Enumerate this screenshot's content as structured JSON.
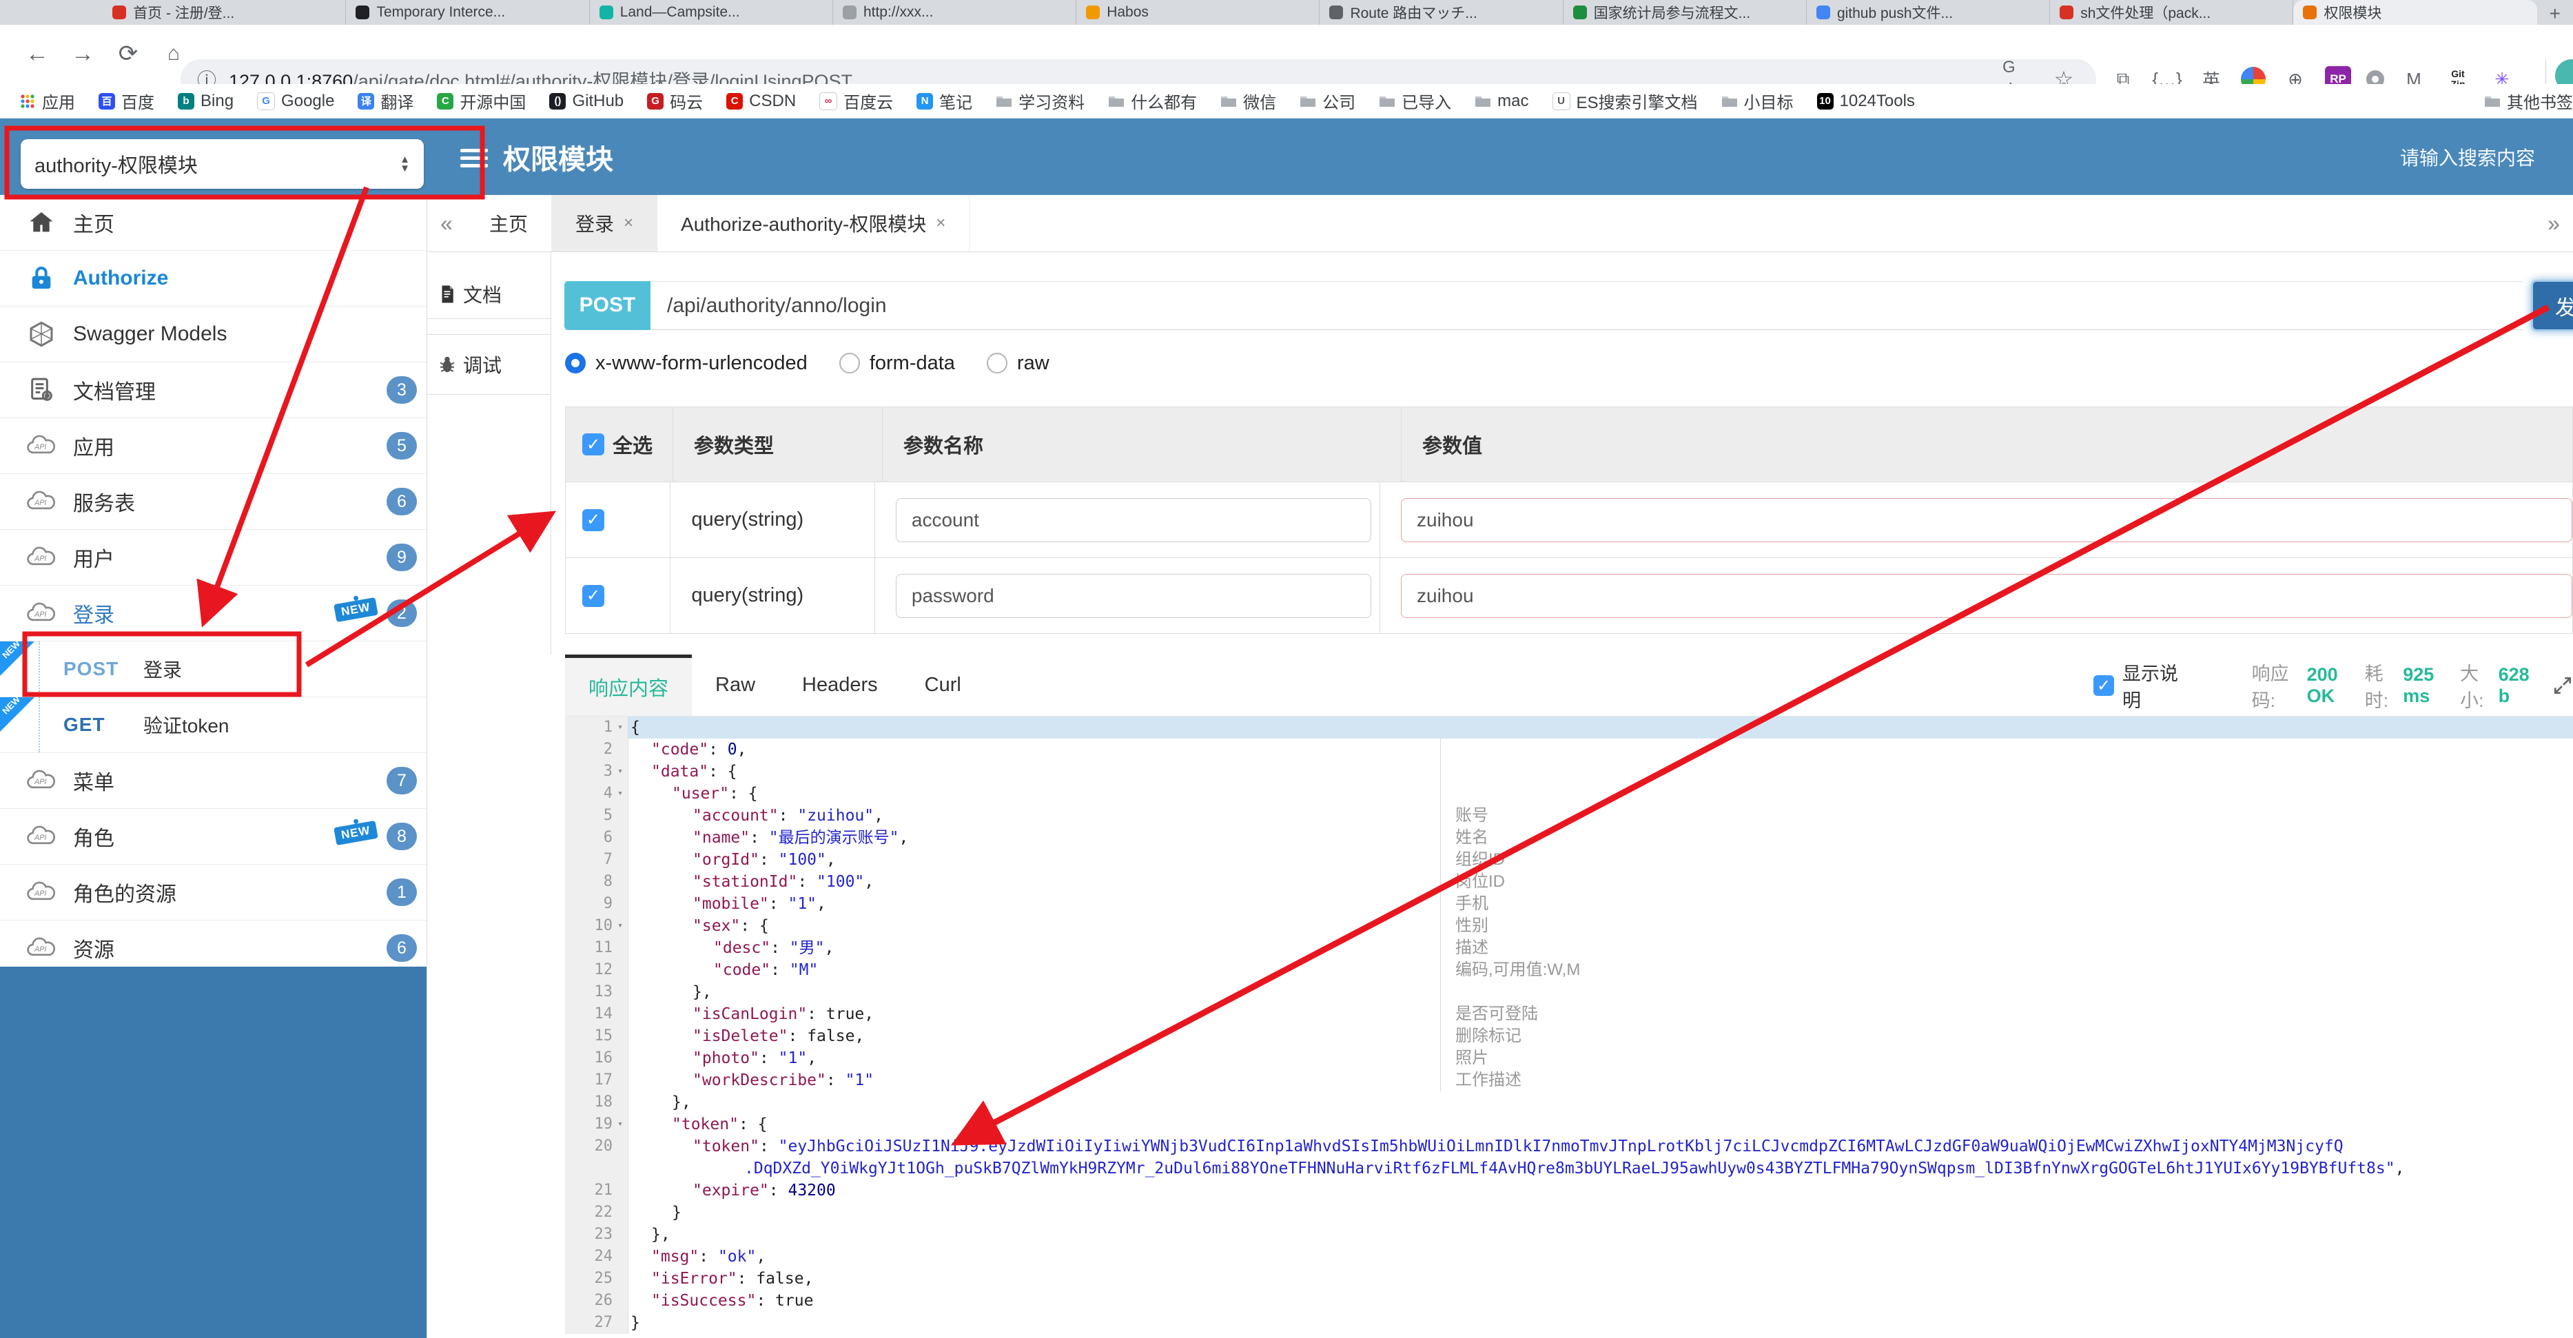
{
  "browser": {
    "tabs": [
      {
        "title": "首页 - 注册/登...",
        "color": "#d93025"
      },
      {
        "title": "Temporary Interce...",
        "color": "#202124"
      },
      {
        "title": "Land—Campsite...",
        "color": "#12b5a5"
      },
      {
        "title": "http://xxx...",
        "color": "#9aa0a6"
      },
      {
        "title": "Habos",
        "color": "#f29900"
      },
      {
        "title": "Route 路由マッチ...",
        "color": "#5f6368"
      },
      {
        "title": "国家统计局参与流程文...",
        "color": "#1e8e3e"
      },
      {
        "title": "github push文件...",
        "color": "#4285f4"
      },
      {
        "title": "sh文件处理（pack...",
        "color": "#d93025"
      },
      {
        "title": "权限模块",
        "color": "#e8710a",
        "active": true
      }
    ],
    "new_tab_label": "+",
    "url_host": "127.0.0.1:8760",
    "url_path": "/api/gate/doc.html#/authority-权限模块/登录/loginUsingPOST",
    "ext_icons": [
      "scan-icon",
      "braces-icon",
      "en-translate-icon",
      "chrome-colored-icon",
      "globe-icon",
      "rp-icon",
      "circle-icon",
      "m-arrow-icon",
      "gitzip-icon",
      "asterisk-icon"
    ],
    "bookmarks": [
      {
        "label": "应用",
        "icon": "grid"
      },
      {
        "label": "百度",
        "icon": "badge",
        "bg": "#2d4ff5",
        "glyph": "百"
      },
      {
        "label": "Bing",
        "icon": "badge",
        "bg": "#008080",
        "glyph": "b"
      },
      {
        "label": "Google",
        "icon": "badge",
        "bg": "#ffffff",
        "fg": "#4285f4",
        "glyph": "G",
        "border": true
      },
      {
        "label": "翻译",
        "icon": "badge",
        "bg": "#3b82f0",
        "glyph": "译"
      },
      {
        "label": "开源中国",
        "icon": "badge",
        "bg": "#28a745",
        "glyph": "C"
      },
      {
        "label": "GitHub",
        "icon": "badge",
        "bg": "#1b1f23",
        "glyph": "()"
      },
      {
        "label": "码云",
        "icon": "badge",
        "bg": "#c71d23",
        "glyph": "G"
      },
      {
        "label": "CSDN",
        "icon": "badge",
        "bg": "#dd1100",
        "glyph": "C"
      },
      {
        "label": "百度云",
        "icon": "badge",
        "bg": "#ffffff",
        "fg": "#d6325e",
        "glyph": "∞",
        "border": true
      },
      {
        "label": "笔记",
        "icon": "badge",
        "bg": "#2196f3",
        "glyph": "N"
      },
      {
        "label": "学习资料",
        "icon": "folder"
      },
      {
        "label": "什么都有",
        "icon": "folder"
      },
      {
        "label": "微信",
        "icon": "folder"
      },
      {
        "label": "公司",
        "icon": "folder"
      },
      {
        "label": "已导入",
        "icon": "folder"
      },
      {
        "label": "mac",
        "icon": "folder"
      },
      {
        "label": "ES搜索引擎文档",
        "icon": "badge",
        "bg": "#ffffff",
        "fg": "#555555",
        "glyph": "U",
        "border": true
      },
      {
        "label": "小目标",
        "icon": "folder"
      },
      {
        "label": "1024Tools",
        "icon": "badge",
        "bg": "#000000",
        "glyph": "10"
      }
    ],
    "other_bookmarks": "其他书签"
  },
  "header": {
    "module_select": "authority-权限模块",
    "title": "权限模块",
    "search_text": "请输入搜索内容"
  },
  "sidebar": {
    "new_tag_label": "NEW",
    "items": [
      {
        "label": "主页",
        "icon": "home"
      },
      {
        "label": "Authorize",
        "icon": "lock",
        "cls": "authorize"
      },
      {
        "label": "Swagger Models",
        "icon": "hexagon"
      },
      {
        "label": "文档管理",
        "icon": "docgear",
        "badge": "3"
      },
      {
        "label": "应用",
        "icon": "cloud",
        "badge": "5"
      },
      {
        "label": "服务表",
        "icon": "cloud",
        "badge": "6"
      },
      {
        "label": "用户",
        "icon": "cloud",
        "badge": "9"
      },
      {
        "label": "登录",
        "icon": "cloud",
        "badge": "2",
        "isNew": true,
        "cls": "active"
      },
      {
        "endpoint": true,
        "method": "POST",
        "label": "登录",
        "ribbon": "NEW"
      },
      {
        "endpoint": true,
        "method": "GET",
        "label": "验证token",
        "ribbon": "NEW"
      },
      {
        "label": "菜单",
        "icon": "cloud",
        "badge": "7"
      },
      {
        "label": "角色",
        "icon": "cloud",
        "badge": "8",
        "isNew": true
      },
      {
        "label": "角色的资源",
        "icon": "cloud",
        "badge": "1"
      },
      {
        "label": "资源",
        "icon": "cloud",
        "badge": "6"
      }
    ]
  },
  "nav_tabs": {
    "collapse": "«",
    "expand": "»",
    "items": [
      {
        "label": "主页"
      },
      {
        "label": "登录",
        "closable": true,
        "active": true
      },
      {
        "label": "Authorize-authority-权限模块",
        "closable": true
      }
    ],
    "close_glyph": "×"
  },
  "side_tabs": [
    {
      "label": "文档",
      "icon": "page"
    },
    {
      "label": "调试",
      "icon": "bug",
      "active": true
    }
  ],
  "request": {
    "method": "POST",
    "path": "/api/authority/anno/login",
    "send_label": "发送",
    "body_types": [
      {
        "label": "x-www-form-urlencoded",
        "selected": true
      },
      {
        "label": "form-data",
        "selected": false
      },
      {
        "label": "raw",
        "selected": false
      }
    ]
  },
  "params_table": {
    "select_all": "全选",
    "headers": [
      "参数类型",
      "参数名称",
      "参数值"
    ],
    "rows": [
      {
        "type": "query(string)",
        "name": "account",
        "value": "zuihou"
      },
      {
        "type": "query(string)",
        "name": "password",
        "value": "zuihou"
      }
    ]
  },
  "response": {
    "tabs": [
      "响应内容",
      "Raw",
      "Headers",
      "Curl"
    ],
    "active_tab": "响应内容",
    "show_desc_label": "显示说明",
    "status": {
      "code_label": "响应码:",
      "code": "200 OK",
      "time_label": "耗时:",
      "time": "925 ms",
      "size_label": "大小:",
      "size": "628 b"
    }
  },
  "editor": {
    "lines": [
      {
        "n": 1,
        "ind": 0,
        "fold": true,
        "hl": true,
        "seg": [
          [
            "{",
            "p"
          ]
        ]
      },
      {
        "n": 2,
        "ind": 1,
        "seg": [
          [
            "\"code\"",
            "k"
          ],
          [
            ": ",
            "p"
          ],
          [
            "0",
            "n"
          ],
          [
            ",",
            "p"
          ]
        ]
      },
      {
        "n": 3,
        "ind": 1,
        "fold": true,
        "seg": [
          [
            "\"data\"",
            "k"
          ],
          [
            ": {",
            "p"
          ]
        ]
      },
      {
        "n": 4,
        "ind": 2,
        "fold": true,
        "seg": [
          [
            "\"user\"",
            "k"
          ],
          [
            ": {",
            "p"
          ]
        ]
      },
      {
        "n": 5,
        "ind": 3,
        "note": "账号",
        "seg": [
          [
            "\"account\"",
            "k"
          ],
          [
            ": ",
            "p"
          ],
          [
            "\"zuihou\"",
            "s"
          ],
          [
            ",",
            "p"
          ]
        ]
      },
      {
        "n": 6,
        "ind": 3,
        "note": "姓名",
        "seg": [
          [
            "\"name\"",
            "k"
          ],
          [
            ": ",
            "p"
          ],
          [
            "\"最后的演示账号\"",
            "s"
          ],
          [
            ",",
            "p"
          ]
        ]
      },
      {
        "n": 7,
        "ind": 3,
        "note": "组织ID",
        "seg": [
          [
            "\"orgId\"",
            "k"
          ],
          [
            ": ",
            "p"
          ],
          [
            "\"100\"",
            "s"
          ],
          [
            ",",
            "p"
          ]
        ]
      },
      {
        "n": 8,
        "ind": 3,
        "note": "岗位ID",
        "seg": [
          [
            "\"stationId\"",
            "k"
          ],
          [
            ": ",
            "p"
          ],
          [
            "\"100\"",
            "s"
          ],
          [
            ",",
            "p"
          ]
        ]
      },
      {
        "n": 9,
        "ind": 3,
        "note": "手机",
        "seg": [
          [
            "\"mobile\"",
            "k"
          ],
          [
            ": ",
            "p"
          ],
          [
            "\"1\"",
            "s"
          ],
          [
            ",",
            "p"
          ]
        ]
      },
      {
        "n": 10,
        "ind": 3,
        "fold": true,
        "note": "性别",
        "seg": [
          [
            "\"sex\"",
            "k"
          ],
          [
            ": {",
            "p"
          ]
        ]
      },
      {
        "n": 11,
        "ind": 4,
        "note": "描述",
        "seg": [
          [
            "\"desc\"",
            "k"
          ],
          [
            ": ",
            "p"
          ],
          [
            "\"男\"",
            "s"
          ],
          [
            ",",
            "p"
          ]
        ]
      },
      {
        "n": 12,
        "ind": 4,
        "note": "编码,可用值:W,M",
        "seg": [
          [
            "\"code\"",
            "k"
          ],
          [
            ": ",
            "p"
          ],
          [
            "\"M\"",
            "s"
          ]
        ]
      },
      {
        "n": 13,
        "ind": 3,
        "seg": [
          [
            "},",
            "p"
          ]
        ]
      },
      {
        "n": 14,
        "ind": 3,
        "note": "是否可登陆",
        "seg": [
          [
            "\"isCanLogin\"",
            "k"
          ],
          [
            ": ",
            "p"
          ],
          [
            "true,",
            "p"
          ]
        ]
      },
      {
        "n": 15,
        "ind": 3,
        "note": "删除标记",
        "seg": [
          [
            "\"isDelete\"",
            "k"
          ],
          [
            ": ",
            "p"
          ],
          [
            "false,",
            "p"
          ]
        ]
      },
      {
        "n": 16,
        "ind": 3,
        "note": "照片",
        "seg": [
          [
            "\"photo\"",
            "k"
          ],
          [
            ": ",
            "p"
          ],
          [
            "\"1\"",
            "s"
          ],
          [
            ",",
            "p"
          ]
        ]
      },
      {
        "n": 17,
        "ind": 3,
        "note": "工作描述",
        "seg": [
          [
            "\"workDescribe\"",
            "k"
          ],
          [
            ": ",
            "p"
          ],
          [
            "\"1\"",
            "s"
          ]
        ]
      },
      {
        "n": 18,
        "ind": 2,
        "seg": [
          [
            "},",
            "p"
          ]
        ]
      },
      {
        "n": 19,
        "ind": 2,
        "fold": true,
        "seg": [
          [
            "\"token\"",
            "k"
          ],
          [
            ": {",
            "p"
          ]
        ]
      },
      {
        "n": 20,
        "ind": 3,
        "seg": [
          [
            "\"token\"",
            "k"
          ],
          [
            ": ",
            "p"
          ],
          [
            "\"eyJhbGciOiJSUzI1NiJ9.eyJzdWIiOiIyIiwiYWNjb3VudCI6Inp1aWhvdSIsIm5hbWUiOiLmnIDlkI7nmoTmvJTnpLrotKblj7ciLCJvcmdpZCI6MTAwLCJzdGF0aW9uaWQiOjEwMCwiZXhwIjoxNTY4MjM3NjcyfQ",
            "s"
          ]
        ]
      },
      {
        "wrap": true,
        "ind": 5.5,
        "seg": [
          [
            ".DqDXZd_Y0iWkgYJt1OGh_puSkB7QZlWmYkH9RZYMr_2uDul6mi88YOneTFHNNuHarviRtf6zFLMLf4AvHQre8m3bUYLRaeLJ95awhUyw0s43BYZTLFMHa79OynSWqpsm_lDI3BfnYnwXrgGOGTeL6htJ1YUIx6Yy19BYBfUft8s\"",
            "s"
          ],
          [
            ",",
            "p"
          ]
        ]
      },
      {
        "n": 21,
        "ind": 3,
        "seg": [
          [
            "\"expire\"",
            "k"
          ],
          [
            ": ",
            "p"
          ],
          [
            "43200",
            "n"
          ]
        ]
      },
      {
        "n": 22,
        "ind": 2,
        "seg": [
          [
            "}",
            "p"
          ]
        ]
      },
      {
        "n": 23,
        "ind": 1,
        "seg": [
          [
            "},",
            "p"
          ]
        ]
      },
      {
        "n": 24,
        "ind": 1,
        "seg": [
          [
            "\"msg\"",
            "k"
          ],
          [
            ": ",
            "p"
          ],
          [
            "\"ok\"",
            "s"
          ],
          [
            ",",
            "p"
          ]
        ]
      },
      {
        "n": 25,
        "ind": 1,
        "seg": [
          [
            "\"isError\"",
            "k"
          ],
          [
            ": ",
            "p"
          ],
          [
            "false,",
            "p"
          ]
        ]
      },
      {
        "n": 26,
        "ind": 1,
        "seg": [
          [
            "\"isSuccess\"",
            "k"
          ],
          [
            ": ",
            "p"
          ],
          [
            "true",
            "p"
          ]
        ]
      },
      {
        "n": 27,
        "ind": 0,
        "seg": [
          [
            "}",
            "p"
          ]
        ]
      }
    ]
  },
  "annotation_color": "#e8171f"
}
